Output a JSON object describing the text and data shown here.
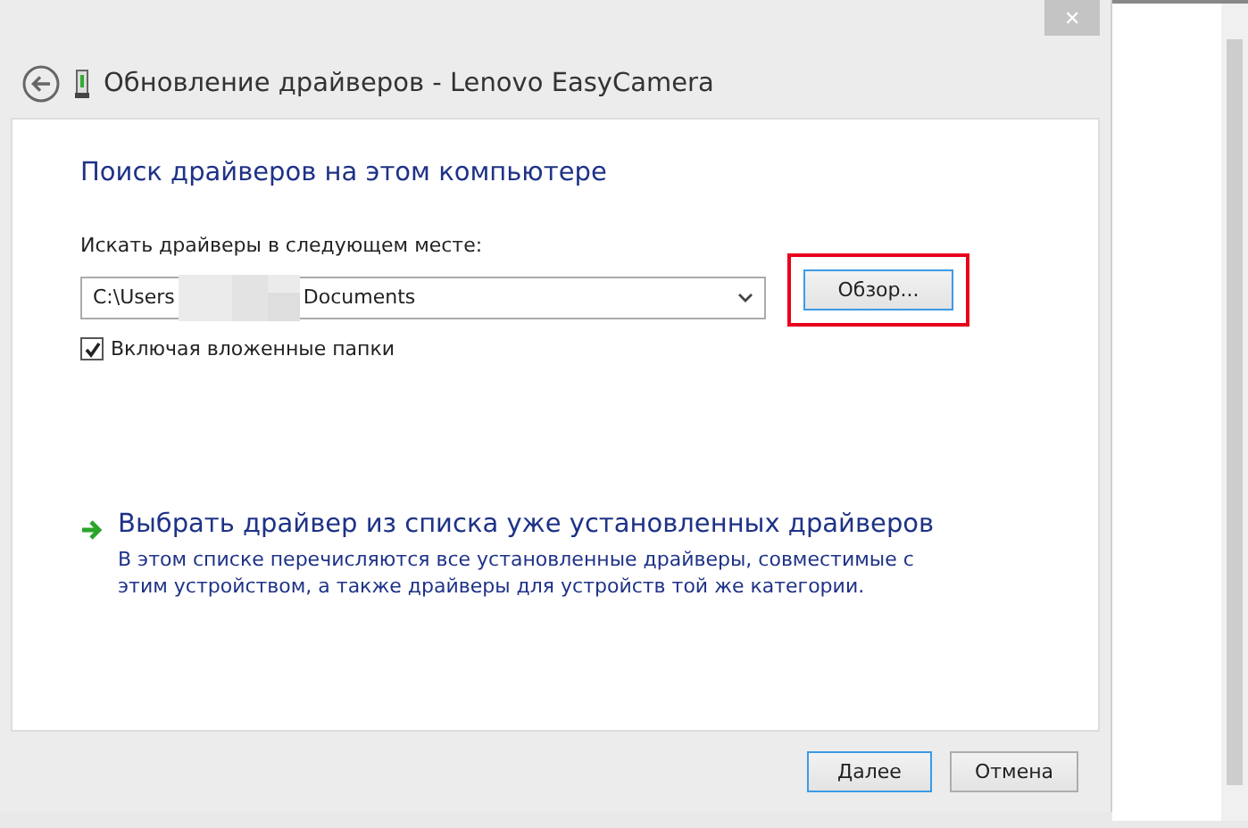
{
  "window": {
    "title": "Обновление драйверов - Lenovo EasyCamera",
    "close_label": "✕"
  },
  "heading": "Поиск драйверов на этом компьютере",
  "location": {
    "label": "Искать драйверы в следующем месте:",
    "path_start": "C:\\Users",
    "path_end": "Documents",
    "browse": "Обзор...",
    "browse_highlighted": true
  },
  "subfolders": {
    "label": "Включая вложенные папки",
    "checked": true
  },
  "pick_link": {
    "title": "Выбрать драйвер из списка уже установленных драйверов",
    "description": "В этом списке перечисляются все установленные драйверы, совместимые с этим устройством, а также драйверы для устройств той же категории."
  },
  "buttons": [
    {
      "label": "Далее",
      "default": true
    },
    {
      "label": "Отмена",
      "default": false
    }
  ]
}
